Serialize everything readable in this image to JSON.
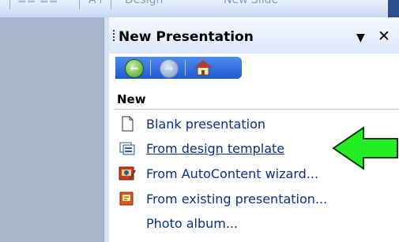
{
  "toolbar": {
    "design_label": "Design",
    "new_slide_label": "New Slide"
  },
  "task_pane": {
    "title": "New Presentation",
    "dropdown_icon": "dropdown-triangle-icon",
    "close_icon": "close-icon",
    "nav": {
      "back_icon": "back-arrow-icon",
      "forward_icon": "forward-arrow-icon",
      "home_icon": "home-icon"
    },
    "section_title": "New",
    "items": [
      {
        "label": "Blank presentation",
        "icon": "blank-page-icon"
      },
      {
        "label": "From design template",
        "icon": "design-template-icon"
      },
      {
        "label": "From AutoContent wizard...",
        "icon": "autocontent-wizard-icon"
      },
      {
        "label": "From existing presentation...",
        "icon": "existing-presentation-icon"
      },
      {
        "label": "Photo album...",
        "icon": ""
      }
    ]
  },
  "annotation": {
    "arrow_color": "#22ee22",
    "arrow_icon": "green-pointer-arrow-icon"
  }
}
